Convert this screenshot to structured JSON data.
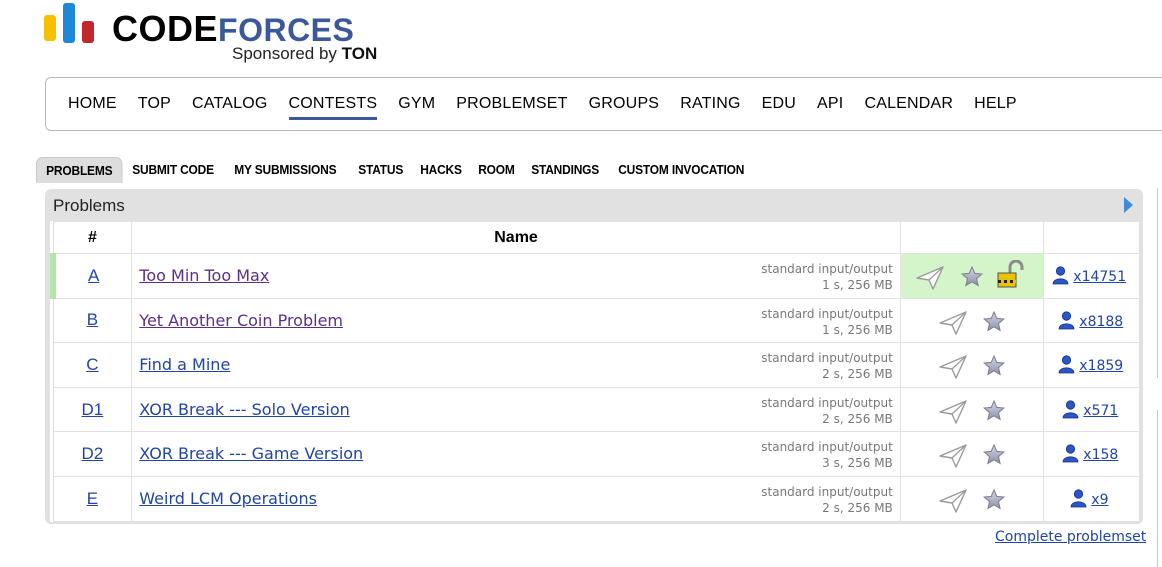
{
  "logo": {
    "word_code": "CODE",
    "word_forces": "FORCES",
    "sponsor_prefix": "Sponsored by ",
    "sponsor_name": "TON"
  },
  "main_menu": [
    "HOME",
    "TOP",
    "CATALOG",
    "CONTESTS",
    "GYM",
    "PROBLEMSET",
    "GROUPS",
    "RATING",
    "EDU",
    "API",
    "CALENDAR",
    "HELP"
  ],
  "main_menu_active": "CONTESTS",
  "second_menu": [
    "PROBLEMS",
    "SUBMIT CODE",
    "MY SUBMISSIONS",
    "STATUS",
    "HACKS",
    "ROOM",
    "STANDINGS",
    "CUSTOM INVOCATION"
  ],
  "second_menu_active": "PROBLEMS",
  "panel": {
    "title": "Problems"
  },
  "table": {
    "headers": {
      "index": "#",
      "name": "Name"
    },
    "rows": [
      {
        "index": "A",
        "name": "Too Min Too Max",
        "io": "standard input/output",
        "limits": "1 s, 256 MB",
        "solved": "x14751",
        "accepted": true
      },
      {
        "index": "B",
        "name": "Yet Another Coin Problem",
        "io": "standard input/output",
        "limits": "1 s, 256 MB",
        "solved": "x8188",
        "accepted": false
      },
      {
        "index": "C",
        "name": "Find a Mine",
        "io": "standard input/output",
        "limits": "2 s, 256 MB",
        "solved": "x1859",
        "accepted": false
      },
      {
        "index": "D1",
        "name": "XOR Break --- Solo Version",
        "io": "standard input/output",
        "limits": "2 s, 256 MB",
        "solved": "x571",
        "accepted": false
      },
      {
        "index": "D2",
        "name": "XOR Break --- Game Version",
        "io": "standard input/output",
        "limits": "3 s, 256 MB",
        "solved": "x158",
        "accepted": false
      },
      {
        "index": "E",
        "name": "Weird LCM Operations",
        "io": "standard input/output",
        "limits": "2 s, 256 MB",
        "solved": "x9",
        "accepted": false
      }
    ]
  },
  "complete_link": "Complete problemset",
  "colors": {
    "link": "#2144a5",
    "accepted_bg": "#d4f5c9",
    "accent": "#3b5998"
  },
  "icons": {
    "submit": "send-icon",
    "favourite": "star-icon",
    "lock": "open-lock-icon",
    "solvers": "user-icon",
    "toggle": "triangle-right-icon"
  }
}
